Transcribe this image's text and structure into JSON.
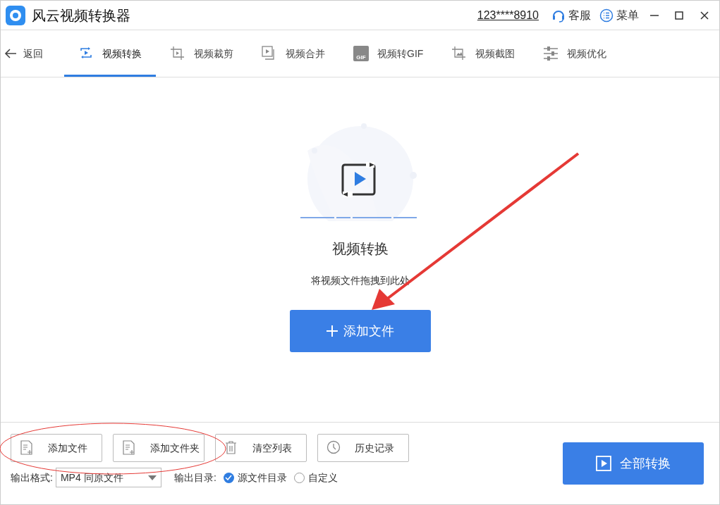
{
  "window": {
    "title": "风云视频转换器",
    "account": "123****8910",
    "service": "客服",
    "menu": "菜单"
  },
  "back": "返回",
  "tabs": [
    {
      "label": "视频转换",
      "kind": "convert",
      "selected": true
    },
    {
      "label": "视频裁剪",
      "kind": "crop",
      "selected": false
    },
    {
      "label": "视频合并",
      "kind": "merge",
      "selected": false
    },
    {
      "label": "视频转GIF",
      "kind": "gif",
      "selected": false,
      "icon_text": "GIF"
    },
    {
      "label": "视频截图",
      "kind": "shot",
      "selected": false
    },
    {
      "label": "视频优化",
      "kind": "tune",
      "selected": false
    }
  ],
  "dropzone": {
    "title": "视频转换",
    "hint": "将视频文件拖拽到此处",
    "button": "添加文件"
  },
  "toolbar": [
    {
      "label": "添加文件",
      "kind": "file"
    },
    {
      "label": "添加文件夹",
      "kind": "file"
    },
    {
      "label": "清空列表",
      "kind": "trash"
    },
    {
      "label": "历史记录",
      "kind": "clock"
    }
  ],
  "output_format": {
    "label": "输出格式:",
    "value": "MP4 同原文件"
  },
  "output_dir": {
    "label": "输出目录:",
    "options": [
      {
        "label": "源文件目录",
        "selected": true
      },
      {
        "label": "自定义",
        "selected": false
      }
    ]
  },
  "convert_all": "全部转换"
}
